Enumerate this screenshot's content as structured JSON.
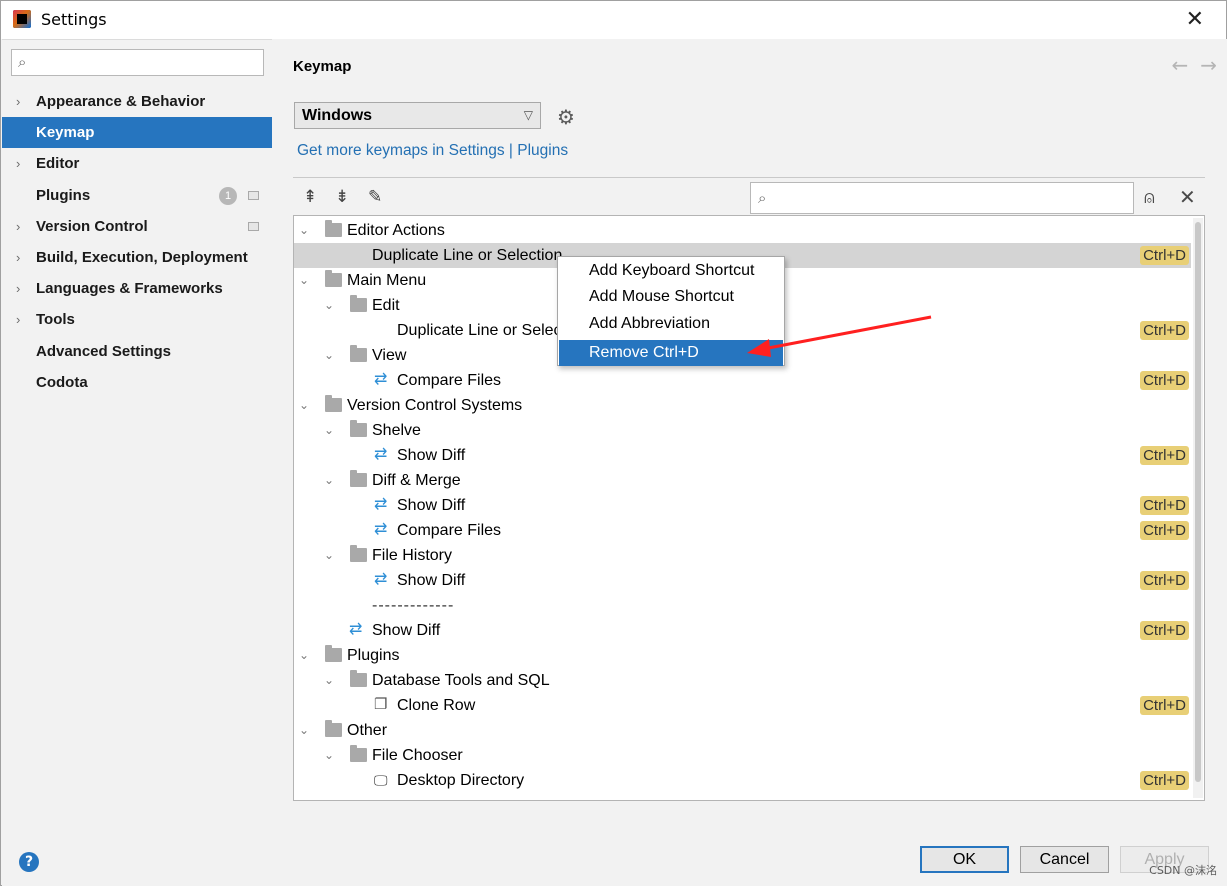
{
  "window": {
    "title": "Settings",
    "close_glyph": "✕"
  },
  "sidebar": {
    "search_placeholder": "",
    "items": [
      {
        "label": "Appearance & Behavior",
        "chevron": "›"
      },
      {
        "label": "Keymap"
      },
      {
        "label": "Editor",
        "chevron": "›"
      },
      {
        "label": "Plugins",
        "badge": "1"
      },
      {
        "label": "Version Control",
        "chevron": "›"
      },
      {
        "label": "Build, Execution, Deployment",
        "chevron": "›"
      },
      {
        "label": "Languages & Frameworks",
        "chevron": "›"
      },
      {
        "label": "Tools",
        "chevron": "›"
      },
      {
        "label": "Advanced Settings"
      },
      {
        "label": "Codota"
      }
    ]
  },
  "main": {
    "heading": "Keymap",
    "back_glyph": "←",
    "forward_glyph": "→",
    "keymap_select": "Windows",
    "get_more_link": "Get more keymaps in Settings | Plugins",
    "filter_placeholder": ""
  },
  "tree": [
    {
      "label": "Editor Actions",
      "toggle": "⌄"
    },
    {
      "label": "Duplicate Line or Selection",
      "shortcut": "Ctrl+D"
    },
    {
      "label": "Main Menu",
      "toggle": "⌄"
    },
    {
      "label": "Edit",
      "toggle": "⌄"
    },
    {
      "label": "Duplicate Line or Selec",
      "shortcut": "Ctrl+D"
    },
    {
      "label": "View",
      "toggle": "⌄"
    },
    {
      "label": "Compare Files",
      "shortcut": "Ctrl+D"
    },
    {
      "label": "Version Control Systems",
      "toggle": "⌄"
    },
    {
      "label": "Shelve",
      "toggle": "⌄"
    },
    {
      "label": "Show Diff",
      "shortcut": "Ctrl+D"
    },
    {
      "label": "Diff & Merge",
      "toggle": "⌄"
    },
    {
      "label": "Show Diff",
      "shortcut": "Ctrl+D"
    },
    {
      "label": "Compare Files",
      "shortcut": "Ctrl+D"
    },
    {
      "label": "File History",
      "toggle": "⌄"
    },
    {
      "label": "Show Diff",
      "shortcut": "Ctrl+D"
    },
    {
      "label": "-------------"
    },
    {
      "label": "Show Diff",
      "shortcut": "Ctrl+D"
    },
    {
      "label": "Plugins",
      "toggle": "⌄"
    },
    {
      "label": "Database Tools and SQL",
      "toggle": "⌄"
    },
    {
      "label": "Clone Row",
      "shortcut": "Ctrl+D"
    },
    {
      "label": "Other",
      "toggle": "⌄"
    },
    {
      "label": "File Chooser",
      "toggle": "⌄"
    },
    {
      "label": "Desktop Directory",
      "shortcut": "Ctrl+D"
    }
  ],
  "context_menu": [
    {
      "label": "Add Keyboard Shortcut"
    },
    {
      "label": "Add Mouse Shortcut"
    },
    {
      "label": "Add Abbreviation"
    },
    {
      "label": "Remove Ctrl+D"
    }
  ],
  "footer": {
    "help": "?",
    "ok": "OK",
    "cancel": "Cancel",
    "apply": "Apply",
    "watermark": "CSDN @沫洺"
  },
  "colors": {
    "selection": "#2675bf",
    "shortcut_badge": "#e8cf76",
    "link": "#2470b3",
    "arrow": "#ff2020"
  }
}
